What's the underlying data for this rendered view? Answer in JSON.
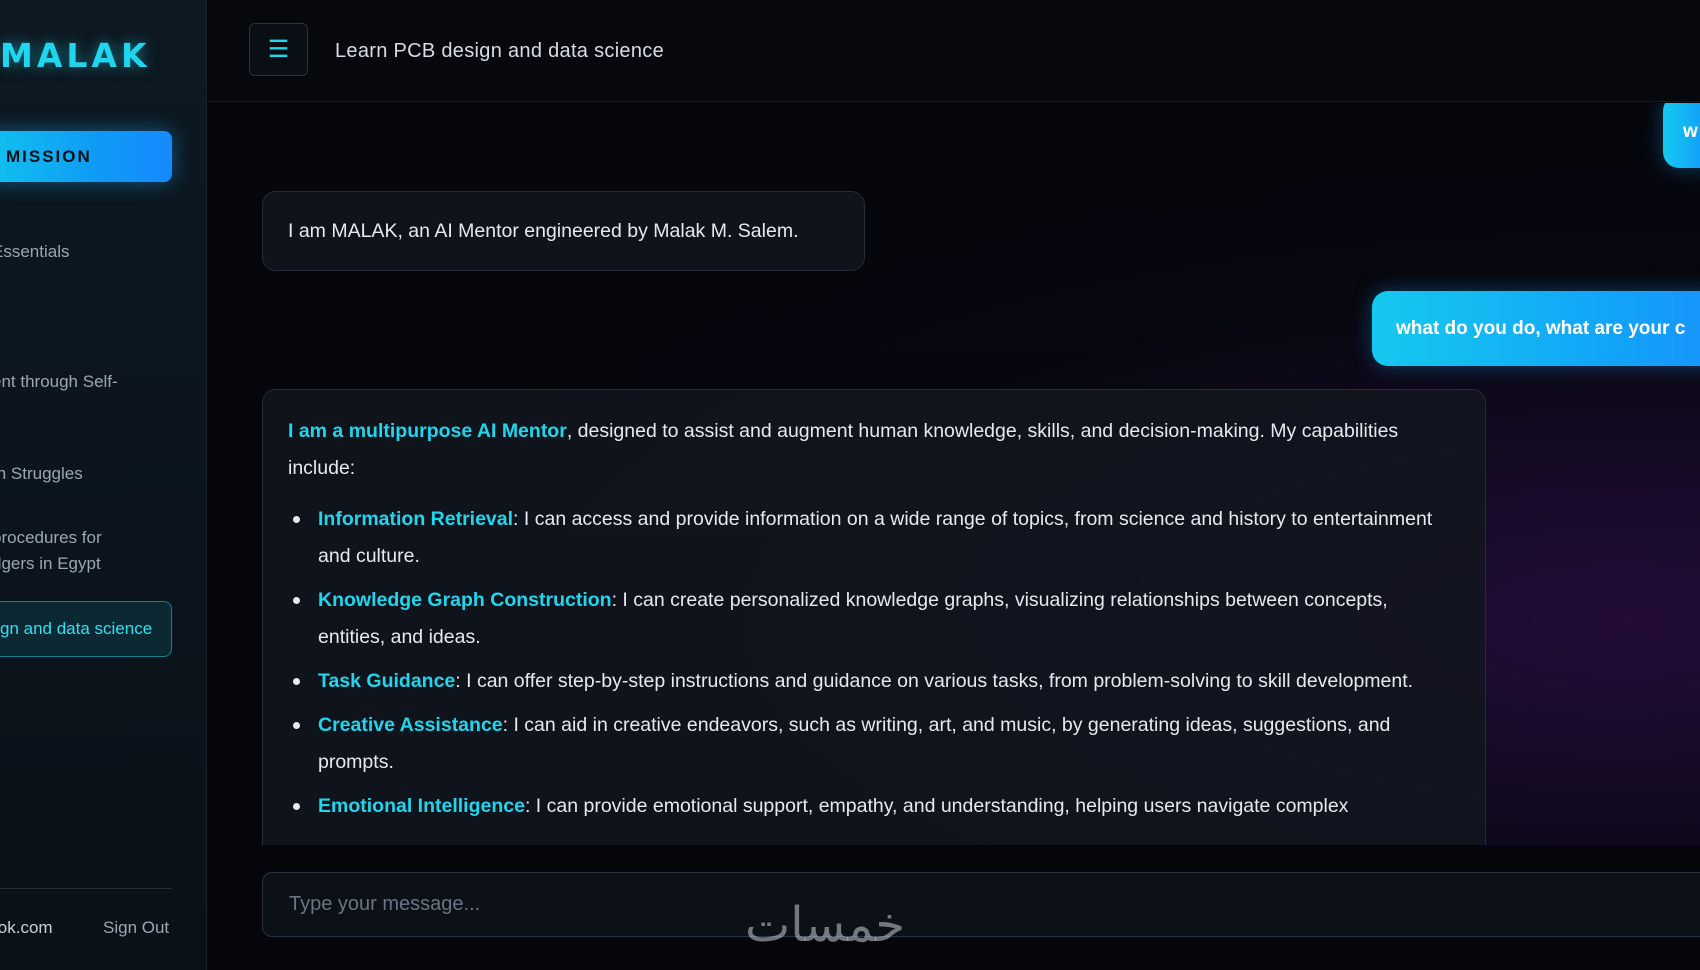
{
  "app": {
    "brand": "MALAK",
    "mission_button": "MISSION"
  },
  "sidebar": {
    "chats": [
      {
        "label": "Essentials",
        "active": false
      },
      {
        "label": "ent through Self-",
        "active": false
      },
      {
        "label": "th Struggles",
        "active": false
      },
      {
        "label": "procedures for",
        "label2": "dgers in Egypt",
        "active": false
      },
      {
        "label": "gn and data science",
        "active": true
      }
    ],
    "user_email": "lok.com",
    "sign_out": "Sign Out"
  },
  "header": {
    "menu_icon": "☰",
    "title": "Learn PCB design and data science"
  },
  "messages": {
    "user_top": "w",
    "ai_intro": "I am MALAK, an AI Mentor engineered by Malak M. Salem.",
    "user_question": "what do you do, what are your c",
    "ai_main": {
      "lead_highlight": "I am a multipurpose AI Mentor",
      "lead_rest": ", designed to assist and augment human knowledge, skills, and decision-making. My capabilities include:",
      "items": [
        {
          "term": "Information Retrieval",
          "text": ": I can access and provide information on a wide range of topics, from science and history to entertainment and culture."
        },
        {
          "term": "Knowledge Graph Construction",
          "text": ": I can create personalized knowledge graphs, visualizing relationships between concepts, entities, and ideas."
        },
        {
          "term": "Task Guidance",
          "text": ": I can offer step-by-step instructions and guidance on various tasks, from problem-solving to skill development."
        },
        {
          "term": "Creative Assistance",
          "text": ": I can aid in creative endeavors, such as writing, art, and music, by generating ideas, suggestions, and prompts."
        },
        {
          "term": "Emotional Intelligence",
          "text": ": I can provide emotional support, empathy, and understanding, helping users navigate complex"
        }
      ]
    }
  },
  "composer": {
    "placeholder": "Type your message..."
  },
  "watermark": "خمسات",
  "colors": {
    "accent": "#1fd6ee",
    "user_bubble": "#12a4f8",
    "background": "#05060b",
    "sidebar": "#0d1820"
  }
}
